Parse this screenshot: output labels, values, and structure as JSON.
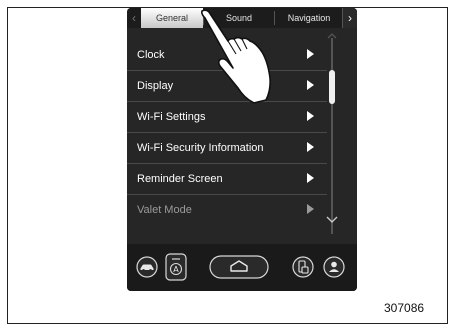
{
  "tabs": {
    "items": [
      {
        "label": "General",
        "active": true
      },
      {
        "label": "Sound",
        "active": false
      },
      {
        "label": "Navigation",
        "active": false
      }
    ]
  },
  "menu": {
    "items": [
      {
        "label": "Clock",
        "enabled": true
      },
      {
        "label": "Display",
        "enabled": true
      },
      {
        "label": "Wi-Fi Settings",
        "enabled": true
      },
      {
        "label": "Wi-Fi Security Information",
        "enabled": true
      },
      {
        "label": "Reminder Screen",
        "enabled": true
      },
      {
        "label": "Valet Mode",
        "enabled": false
      }
    ]
  },
  "bottom_bar": {
    "buttons": [
      {
        "icon": "car-icon"
      },
      {
        "icon": "auto-mode-icon"
      },
      {
        "icon": "home-icon"
      },
      {
        "icon": "phone-projection-icon"
      },
      {
        "icon": "user-icon"
      }
    ]
  },
  "figure_id": "307086",
  "colors": {
    "screen_bg": "#262626",
    "active_tab": "#e0e0e0",
    "text": "#ffffff",
    "disabled_text": "#9a9a9a"
  }
}
